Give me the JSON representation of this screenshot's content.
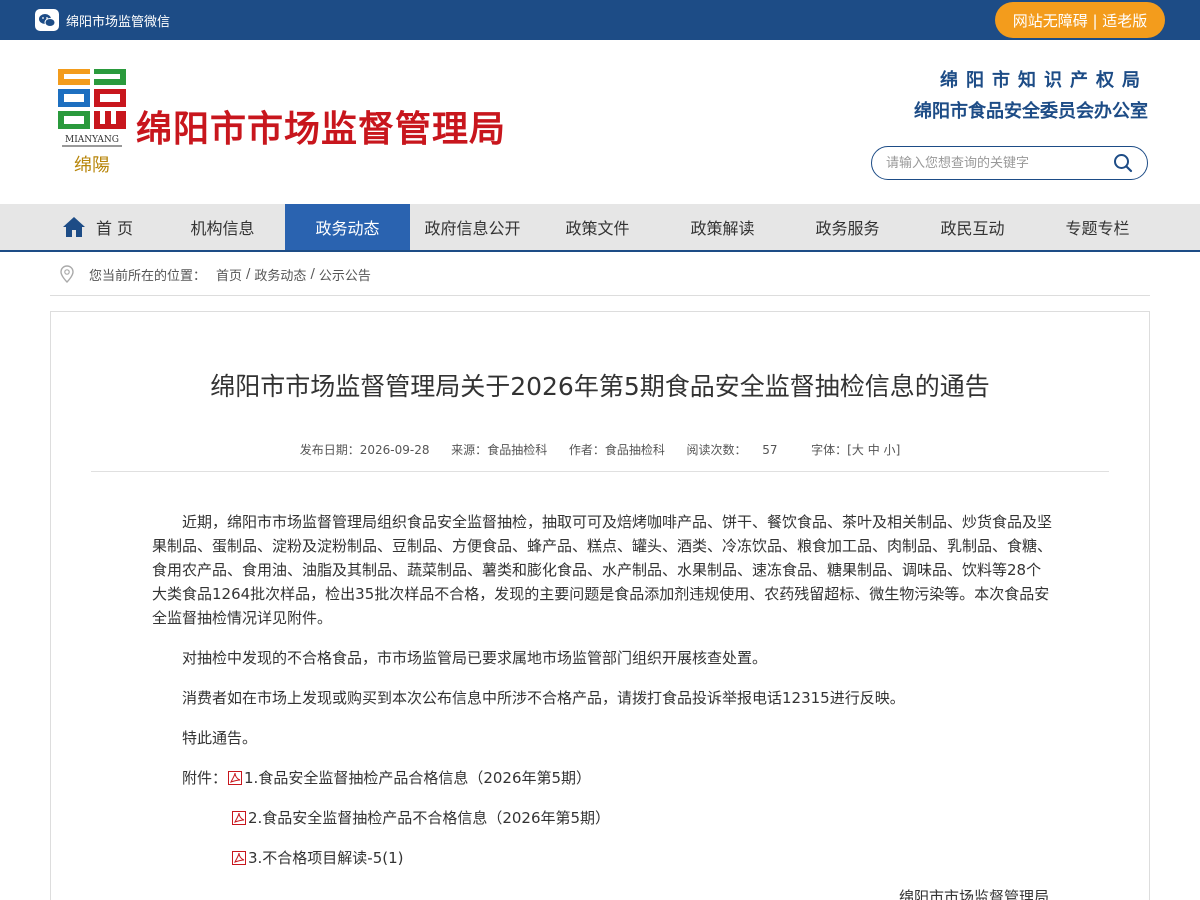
{
  "topbar": {
    "wechat_label": "绵阳市场监管微信",
    "accessibility_label": "网站无障碍 | 适老版"
  },
  "header": {
    "site_title": "绵阳市市场监督管理局",
    "logo_en": "MIANYANG",
    "logo_cn": "绵陽",
    "org_line1": "绵阳市知识产权局",
    "org_line2": "绵阳市食品安全委员会办公室",
    "search_placeholder": "请输入您想查询的关键字"
  },
  "nav": {
    "items": [
      {
        "label": "首 页"
      },
      {
        "label": "机构信息"
      },
      {
        "label": "政务动态"
      },
      {
        "label": "政府信息公开"
      },
      {
        "label": "政策文件"
      },
      {
        "label": "政策解读"
      },
      {
        "label": "政务服务"
      },
      {
        "label": "政民互动"
      },
      {
        "label": "专题专栏"
      }
    ],
    "active_index": 2
  },
  "breadcrumb": {
    "prefix": "您当前所在的位置：",
    "items": [
      "首页",
      "政务动态",
      "公示公告"
    ],
    "separator": "/"
  },
  "article": {
    "title": "绵阳市市场监督管理局关于2026年第5期食品安全监督抽检信息的通告",
    "meta": {
      "date_label": "发布日期：",
      "date": "2026-09-28",
      "source_label": "来源：",
      "source": "食品抽检科",
      "author_label": "作者：",
      "author": "食品抽检科",
      "views_label": "阅读次数：",
      "views": "57",
      "font_label": "字体：",
      "font_open": "[",
      "font_large": "大",
      "font_medium": "中",
      "font_small": "小",
      "font_close": "]"
    },
    "paragraphs": [
      "近期，绵阳市市场监督管理局组织食品安全监督抽检，抽取可可及焙烤咖啡产品、饼干、餐饮食品、茶叶及相关制品、炒货食品及坚果制品、蛋制品、淀粉及淀粉制品、豆制品、方便食品、蜂产品、糕点、罐头、酒类、冷冻饮品、粮食加工品、肉制品、乳制品、食糖、食用农产品、食用油、油脂及其制品、蔬菜制品、薯类和膨化食品、水产制品、水果制品、速冻食品、糖果制品、调味品、饮料等28个大类食品1264批次样品，检出35批次样品不合格，发现的主要问题是食品添加剂违规使用、农药残留超标、微生物污染等。本次食品安全监督抽检情况详见附件。",
      "对抽检中发现的不合格食品，市市场监管局已要求属地市场监管部门组织开展核查处置。",
      "消费者如在市场上发现或购买到本次公布信息中所涉不合格产品，请拨打食品投诉举报电话12315进行反映。",
      "特此通告。"
    ],
    "attachments_label": "附件：",
    "attachments": [
      "1.食品安全监督抽检产品合格信息（2026年第5期）",
      "2.食品安全监督抽检产品不合格信息（2026年第5期）",
      "3.不合格项目解读-5(1)"
    ],
    "signature": "绵阳市市场监督管理局"
  },
  "colors": {
    "brand_blue": "#1d4c86",
    "nav_active": "#2a63b0",
    "accent_orange": "#f39c1c",
    "logo_red": "#c8161d"
  }
}
